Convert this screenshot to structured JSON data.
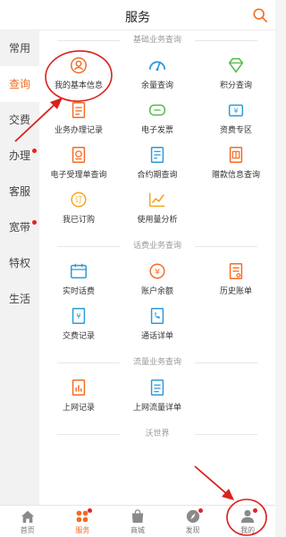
{
  "header": {
    "title": "服务",
    "search_icon": "search-icon"
  },
  "sidebar": {
    "items": [
      {
        "label": "常用",
        "active": false,
        "dot": false
      },
      {
        "label": "查询",
        "active": true,
        "dot": false
      },
      {
        "label": "交费",
        "active": false,
        "dot": false
      },
      {
        "label": "办理",
        "active": false,
        "dot": true
      },
      {
        "label": "客服",
        "active": false,
        "dot": false
      },
      {
        "label": "宽带",
        "active": false,
        "dot": true
      },
      {
        "label": "特权",
        "active": false,
        "dot": false
      },
      {
        "label": "生活",
        "active": false,
        "dot": false
      }
    ]
  },
  "sections": [
    {
      "title": "基础业务查询",
      "items": [
        {
          "label": "我的基本信息",
          "icon": "user-icon"
        },
        {
          "label": "余量查询",
          "icon": "gauge-icon"
        },
        {
          "label": "积分查询",
          "icon": "diamond-icon"
        },
        {
          "label": "业务办理记录",
          "icon": "document-icon"
        },
        {
          "label": "电子发票",
          "icon": "invoice-icon"
        },
        {
          "label": "资费专区",
          "icon": "wallet-icon"
        },
        {
          "label": "电子受理单查询",
          "icon": "receipt-icon"
        },
        {
          "label": "合约期查询",
          "icon": "contract-icon"
        },
        {
          "label": "赠款信息查询",
          "icon": "gift-doc-icon"
        },
        {
          "label": "我已订购",
          "icon": "order-icon"
        },
        {
          "label": "使用量分析",
          "icon": "trend-icon"
        }
      ]
    },
    {
      "title": "话费业务查询",
      "items": [
        {
          "label": "实时话费",
          "icon": "calendar-icon"
        },
        {
          "label": "账户余额",
          "icon": "coin-icon"
        },
        {
          "label": "历史账单",
          "icon": "bill-icon"
        },
        {
          "label": "交费记录",
          "icon": "payment-doc-icon"
        },
        {
          "label": "通话详单",
          "icon": "call-list-icon"
        }
      ]
    },
    {
      "title": "流量业务查询",
      "items": [
        {
          "label": "上网记录",
          "icon": "chart-doc-icon"
        },
        {
          "label": "上网流量详单",
          "icon": "data-list-icon"
        }
      ]
    },
    {
      "title": "沃世界",
      "items": []
    }
  ],
  "bottom_nav": [
    {
      "label": "首页",
      "icon": "home-icon",
      "active": false,
      "dot": false
    },
    {
      "label": "服务",
      "icon": "service-icon",
      "active": true,
      "dot": true
    },
    {
      "label": "商城",
      "icon": "shop-icon",
      "active": false,
      "dot": false
    },
    {
      "label": "发现",
      "icon": "compass-icon",
      "active": false,
      "dot": true
    },
    {
      "label": "我的",
      "icon": "profile-icon",
      "active": false,
      "dot": true
    }
  ],
  "colors": {
    "accent": "#f36b22",
    "icon_blue": "#2b9bd8",
    "icon_green": "#54b84a",
    "annotation_red": "#d9211e"
  }
}
